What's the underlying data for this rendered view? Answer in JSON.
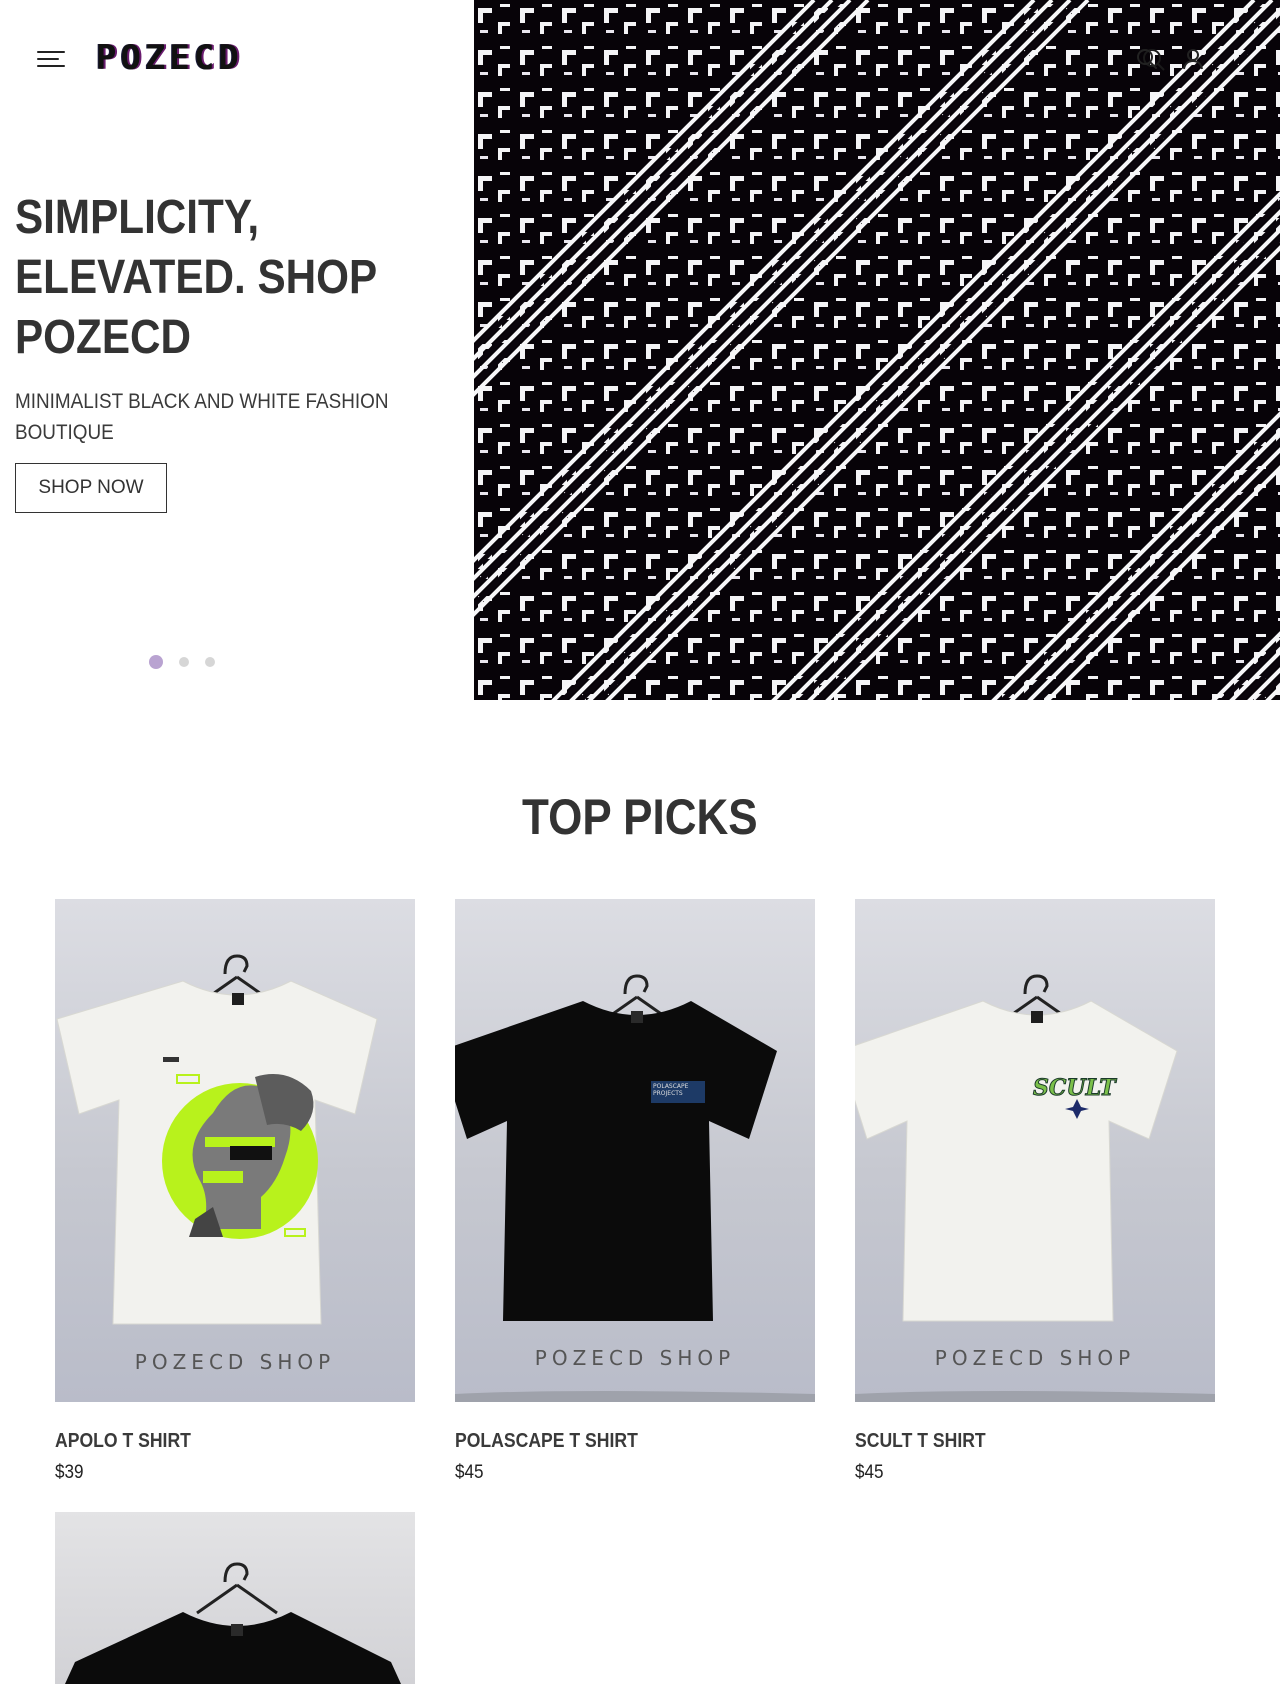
{
  "header": {
    "logo_text": "POZECD",
    "menu_icon": "hamburger-menu-icon",
    "search_icon": "search-icon",
    "account_icon": "account-icon"
  },
  "hero": {
    "title": "SIMPLICITY, ELEVATED. SHOP POZECD",
    "subtitle": "MINIMALIST BLACK AND WHITE FASHION BOUTIQUE",
    "cta_label": "SHOP NOW",
    "slide_count": 3,
    "active_slide": 1,
    "accent_color": "#b9a3d1"
  },
  "top_picks": {
    "title": "TOP PICKS",
    "products": [
      {
        "name": "APOLO T SHIRT",
        "price": "$39",
        "watermark": "POZECD SHOP",
        "shirt_color": "#f2f2ee",
        "print": "statue with green circle"
      },
      {
        "name": "POLASCAPE T SHIRT",
        "price": "$45",
        "watermark": "POZECD SHOP",
        "shirt_color": "#0b0b0b",
        "print": "POLASCAPE PROJECTS"
      },
      {
        "name": "SCULT T SHIRT",
        "price": "$45",
        "watermark": "POZECD SHOP",
        "shirt_color": "#f2f2ee",
        "print": "SCULT"
      },
      {
        "shirt_color": "#0b0b0b"
      }
    ]
  }
}
